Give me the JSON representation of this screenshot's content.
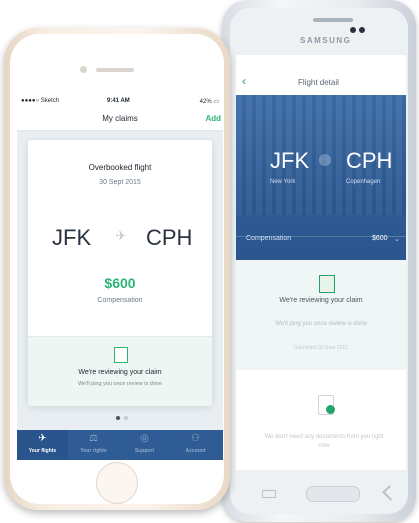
{
  "samsung": {
    "brand": "SAMSUNG",
    "screen": {
      "status_time": "",
      "nav_title": "Flight detail",
      "back_icon": "chevron-left-icon",
      "from_code": "JFK",
      "from_city": "New York",
      "to_code": "CPH",
      "to_city": "Copenhagen",
      "compensation_label": "Compensation",
      "compensation_value": "$600",
      "review_title": "We're reviewing your claim",
      "review_sub": "We'll ping you once review is done",
      "review_date": "Submitted 30 Sept 2015",
      "docs_text": "We don't need any documents from you right now"
    }
  },
  "iphone": {
    "status": {
      "carrier": "Sketch",
      "time": "9:41 AM",
      "battery": "42%"
    },
    "nav": {
      "title": "My claims",
      "action": "Add"
    },
    "card": {
      "title": "Overbooked flight",
      "date": "30 Sept 2015",
      "from_code": "JFK",
      "to_code": "CPH",
      "amount": "$600",
      "amount_label": "Compensation",
      "review_title": "We're reviewing your claim",
      "review_sub": "We'll ping you once review is done"
    },
    "pager": {
      "count": 2,
      "active": 1
    },
    "tabs": [
      {
        "label": "Your flights",
        "icon": "plane-icon",
        "active": true
      },
      {
        "label": "Your rights",
        "icon": "scales-icon",
        "active": false
      },
      {
        "label": "Support",
        "icon": "lifebuoy-icon",
        "active": false
      },
      {
        "label": "Account",
        "icon": "user-icon",
        "active": false
      }
    ]
  },
  "colors": {
    "brand_blue": "#2f5c95",
    "accent_green": "#2bb673",
    "tab_inactive": "#8ea9ca"
  }
}
